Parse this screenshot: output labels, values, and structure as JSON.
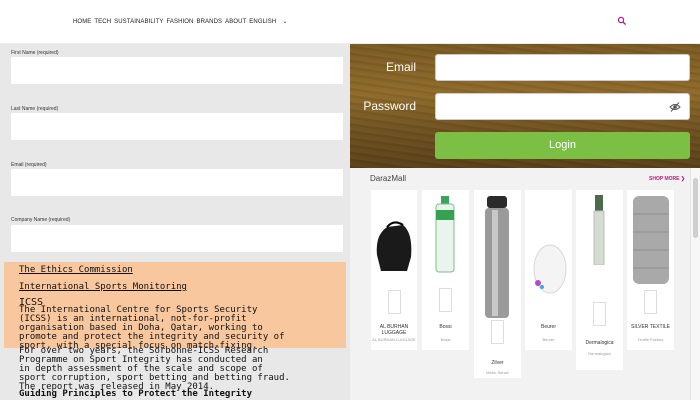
{
  "nav": {
    "items": [
      "HOME",
      "TECH",
      "SUSTAINABILITY",
      "FASHION",
      "BRANDS",
      "ABOUT",
      "ENGLISH"
    ],
    "chevron": "⌄",
    "search_icon": "search-icon"
  },
  "form": {
    "first_name_label": "First Name (required)",
    "last_name_label": "Last Name (required)",
    "email_label": "Email (required)",
    "company_label": "Company Name (required)"
  },
  "login": {
    "email_label": "Email",
    "password_label": "Password",
    "button_label": "Login",
    "accent": "#7bbf44"
  },
  "mall": {
    "title": "DarazMall",
    "shop_more": "SHOP MORE ❯",
    "products": [
      {
        "name": "AL BURHAN LUGGAGE",
        "sub": "AL BURHAN LUGGAGE"
      },
      {
        "name": "Bossi",
        "sub": "Bossi"
      },
      {
        "name": "Zilver",
        "sub": "Metro Sense"
      },
      {
        "name": "Beurer",
        "sub": "Beurer"
      },
      {
        "name": "Dermalogica",
        "sub": "Dermalogica"
      },
      {
        "name": "SILVER TEXTILE",
        "sub": "Textile Factory"
      }
    ]
  },
  "ethics": {
    "link1": "The Ethics Commission",
    "link2": "International Sports Monitoring",
    "heading": "ICSS",
    "para1": "The International Centre for Sports Security\n(ICSS) is an international, not-for-profit\norganisation based in Doha, Qatar, working to\npromote and protect the integrity and security of\nsport, with a special focus on match-fixing.",
    "para2": "For over two years, the Sorbonne-ICSS Research\nProgramme on Sport Integrity has conducted an\nin depth assessment of the scale and scope of\nsport corruption, sport betting and betting fraud.\nThe report was released in May 2014.",
    "para3": "Guiding Principles to Protect the Integrity"
  }
}
